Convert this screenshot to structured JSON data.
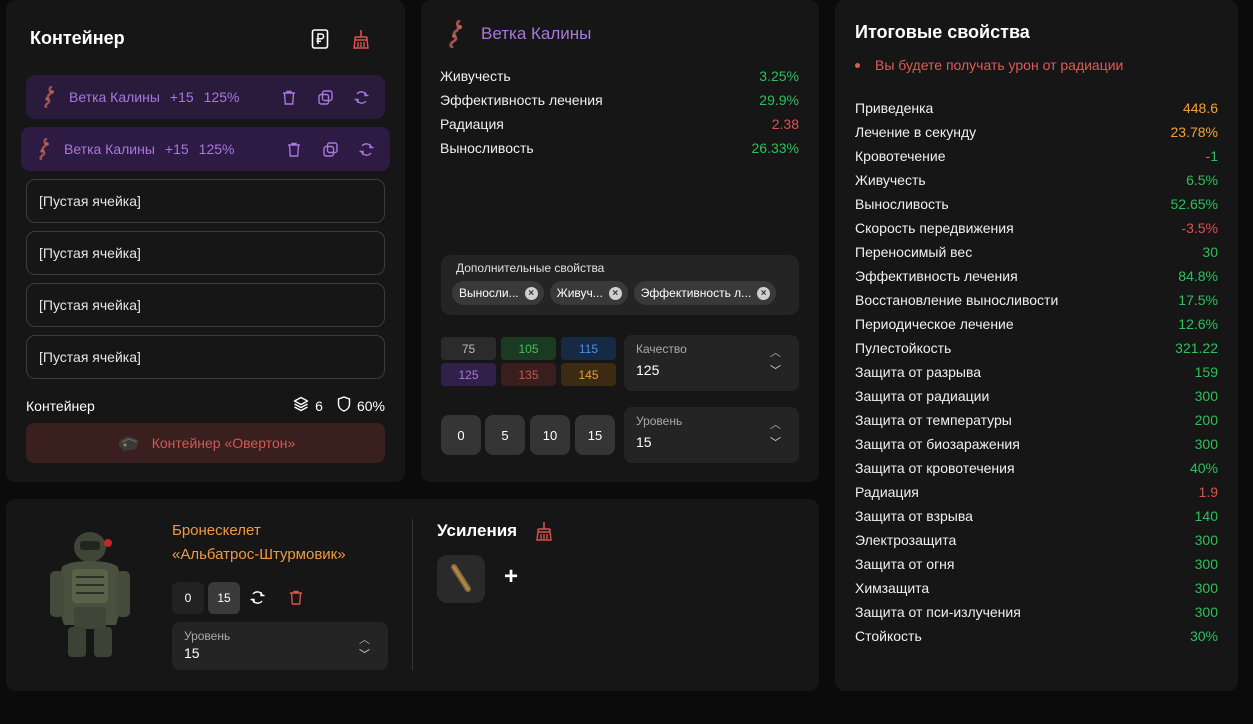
{
  "container_panel": {
    "title": "Контейнер",
    "slots": [
      {
        "name": "Ветка Калины",
        "plus": "+15",
        "quality": "125%"
      },
      {
        "name": "Ветка Калины",
        "plus": "+15",
        "quality": "125%"
      }
    ],
    "empty_slots": [
      "[Пустая ячейка]",
      "[Пустая ячейка]",
      "[Пустая ячейка]",
      "[Пустая ячейка]"
    ],
    "footer_label": "Контейнер",
    "capacity": "6",
    "protection": "60%",
    "container_button": "Контейнер «Овертон»"
  },
  "artifact_panel": {
    "name": "Ветка Калины",
    "stats": [
      {
        "label": "Живучесть",
        "value": "3.25%",
        "color": "#2fbf5c"
      },
      {
        "label": "Эффективность лечения",
        "value": "29.9%",
        "color": "#2fbf5c"
      },
      {
        "label": "Радиация",
        "value": "2.38",
        "color": "#d9534f"
      },
      {
        "label": "Выносливость",
        "value": "26.33%",
        "color": "#2fbf5c"
      }
    ],
    "extra_title": "Дополнительные свойства",
    "chips": [
      "Выносли...",
      "Живуч...",
      "Эффективность л..."
    ],
    "quality_options": [
      {
        "value": "75",
        "bg": "#2b2b2b",
        "fg": "#bdbdbd"
      },
      {
        "value": "105",
        "bg": "#1b3a22",
        "fg": "#3fc25f"
      },
      {
        "value": "115",
        "bg": "#172a45",
        "fg": "#4b8fe0"
      },
      {
        "value": "125",
        "bg": "#31204a",
        "fg": "#a877dd"
      },
      {
        "value": "135",
        "bg": "#3a1d1d",
        "fg": "#c15a54"
      },
      {
        "value": "145",
        "bg": "#3d2a12",
        "fg": "#e0a13a"
      }
    ],
    "quality_label": "Качество",
    "quality_value": "125",
    "level_buttons": [
      "0",
      "5",
      "10",
      "15"
    ],
    "level_label": "Уровень",
    "level_value": "15"
  },
  "armor_panel": {
    "name_line1": "Бронескелет",
    "name_line2": "«Альбатрос-Штурмовик»",
    "level_buttons": [
      "0",
      "15"
    ],
    "level_label": "Уровень",
    "level_value": "15",
    "boosts_title": "Усиления",
    "plus": "+"
  },
  "totals_panel": {
    "title": "Итоговые свойства",
    "warning": "Вы будете получать урон от радиации",
    "stats": [
      {
        "label": "Приведенка",
        "value": "448.6",
        "color": "#f0a23a"
      },
      {
        "label": "Лечение в секунду",
        "value": "23.78%",
        "color": "#f0a23a"
      },
      {
        "label": "Кровотечение",
        "value": "-1",
        "color": "#2fbf5c"
      },
      {
        "label": "Живучесть",
        "value": "6.5%",
        "color": "#2fbf5c"
      },
      {
        "label": "Выносливость",
        "value": "52.65%",
        "color": "#2fbf5c"
      },
      {
        "label": "Скорость передвижения",
        "value": "-3.5%",
        "color": "#d9534f"
      },
      {
        "label": "Переносимый вес",
        "value": "30",
        "color": "#2fbf5c"
      },
      {
        "label": "Эффективность лечения",
        "value": "84.8%",
        "color": "#2fbf5c"
      },
      {
        "label": "Восстановление выносливости",
        "value": "17.5%",
        "color": "#2fbf5c"
      },
      {
        "label": "Периодическое лечение",
        "value": "12.6%",
        "color": "#2fbf5c"
      },
      {
        "label": "Пулестойкость",
        "value": "321.22",
        "color": "#2fbf5c"
      },
      {
        "label": "Защита от разрыва",
        "value": "159",
        "color": "#2fbf5c"
      },
      {
        "label": "Защита от радиации",
        "value": "300",
        "color": "#2fbf5c"
      },
      {
        "label": "Защита от температуры",
        "value": "200",
        "color": "#2fbf5c"
      },
      {
        "label": "Защита от биозаражения",
        "value": "300",
        "color": "#2fbf5c"
      },
      {
        "label": "Защита от кровотечения",
        "value": "40%",
        "color": "#2fbf5c"
      },
      {
        "label": "Радиация",
        "value": "1.9",
        "color": "#d9534f"
      },
      {
        "label": "Защита от взрыва",
        "value": "140",
        "color": "#2fbf5c"
      },
      {
        "label": "Электрозащита",
        "value": "300",
        "color": "#2fbf5c"
      },
      {
        "label": "Защита от огня",
        "value": "300",
        "color": "#2fbf5c"
      },
      {
        "label": "Химзащита",
        "value": "300",
        "color": "#2fbf5c"
      },
      {
        "label": "Защита от пси-излучения",
        "value": "300",
        "color": "#2fbf5c"
      },
      {
        "label": "Стойкость",
        "value": "30%",
        "color": "#2fbf5c"
      }
    ]
  }
}
